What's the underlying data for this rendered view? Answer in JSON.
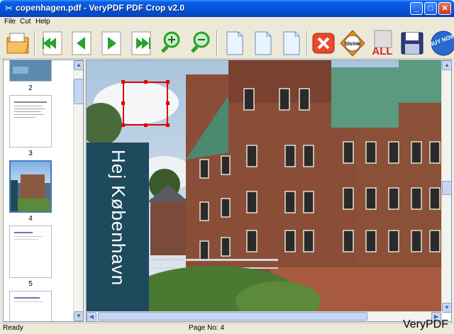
{
  "window": {
    "title": "copenhagen.pdf - VeryPDF PDF Crop v2.0",
    "colors": {
      "titlebar": "#0553da",
      "banner": "#1e4a5e",
      "crop_box": "#e00000"
    }
  },
  "menu": {
    "items": [
      "File",
      "Cut",
      "Help"
    ]
  },
  "toolbar": {
    "tools": [
      {
        "icon": "open-folder-icon"
      },
      {
        "icon": "first-page-icon"
      },
      {
        "icon": "previous-page-icon"
      },
      {
        "icon": "next-page-icon"
      },
      {
        "icon": "last-page-icon"
      },
      {
        "icon": "zoom-in-icon"
      },
      {
        "icon": "zoom-out-icon"
      },
      {
        "icon": "page-icon"
      },
      {
        "icon": "page-icon"
      },
      {
        "icon": "page-icon"
      },
      {
        "icon": "delete-icon"
      },
      {
        "icon": "shrink-icon",
        "label": "Shrink"
      },
      {
        "icon": "crop-all-icon",
        "label": "ALL"
      },
      {
        "icon": "save-icon"
      },
      {
        "icon": "buy-now-icon",
        "label": "BUY NOW"
      }
    ]
  },
  "thumbnails": {
    "labels": [
      "2",
      "3",
      "4",
      "5"
    ],
    "selected": "4"
  },
  "viewer": {
    "banner_text": "Hej København"
  },
  "status": {
    "left": "Ready",
    "page": "Page No: 4"
  },
  "watermark": "VeryPDF"
}
